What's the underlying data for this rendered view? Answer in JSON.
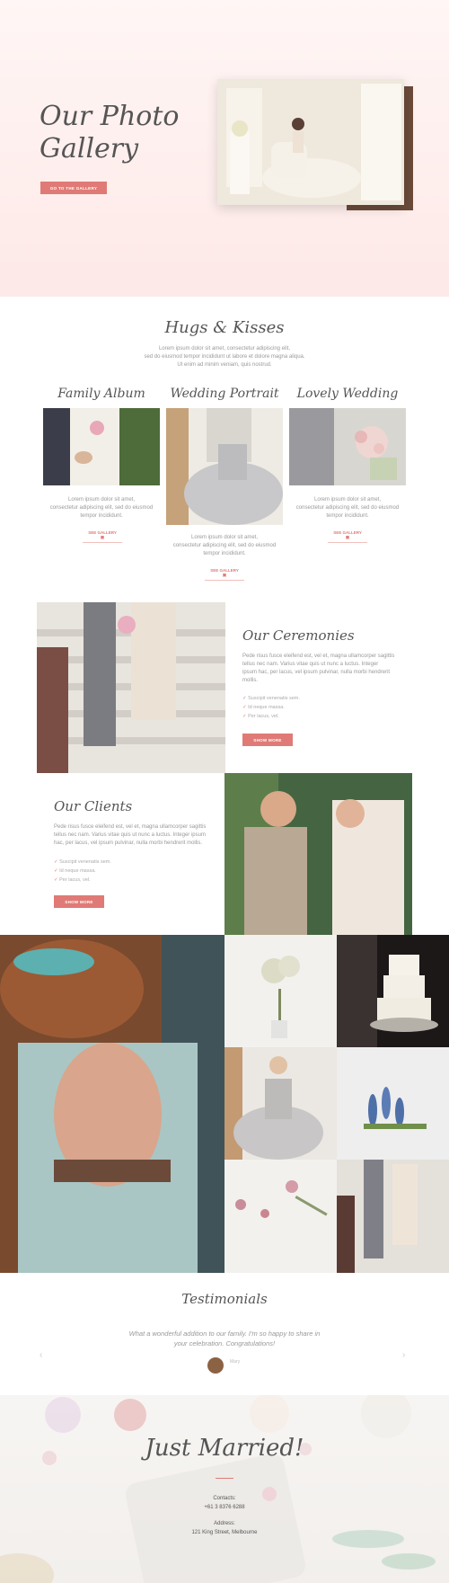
{
  "hero": {
    "title_line1": "Our Photo",
    "title_line2": "Gallery",
    "button_label": "GO TO THE GALLERY"
  },
  "hugs": {
    "title": "Hugs & Kisses",
    "text_line1": "Lorem ipsum dolor sit amet, consectetur adipiscing elit,",
    "text_line2": "sed do eiusmod tempor incididunt ut labore et dolore magna aliqua.",
    "text_line3": "Ut enim ad minim veniam, quis nostrud."
  },
  "albums": [
    {
      "title": "Family Album",
      "text_line1": "Lorem ipsum dolor sit amet,",
      "text_line2": "consectetur adipiscing elit, sed do eiusmod",
      "text_line3": "tempor incididunt.",
      "link_label": "SEE GALLERY"
    },
    {
      "title": "Wedding Portrait",
      "text_line1": "Lorem ipsum dolor sit amet,",
      "text_line2": "consectetur adipiscing elit, sed do eiusmod",
      "text_line3": "tempor incididunt.",
      "link_label": "SEE GALLERY"
    },
    {
      "title": "Lovely Wedding",
      "text_line1": "Lorem ipsum dolor sit amet,",
      "text_line2": "consectetur adipiscing elit, sed do eiusmod",
      "text_line3": "tempor incididunt.",
      "link_label": "SEE GALLERY"
    }
  ],
  "ceremonies": {
    "title": "Our Ceremonies",
    "text_line1": "Pede risus fusce eleifend est, vel et, magna ullamcorper sagittis",
    "text_line2": "tellus nec nam. Varius vitae quis ut nunc a luctus. Integer",
    "text_line3": "ipsum hac, per lacus, vel ipsum pulvinar, nulla morbi hendrerit",
    "text_line4": "mollis.",
    "list": [
      "Suscipit venenatis sem.",
      "Id neque massa.",
      "Per lacus, vel."
    ],
    "button_label": "SHOW MORE"
  },
  "clients": {
    "title": "Our Clients",
    "text_line1": "Pede risus fusce eleifend est, vel et, magna ullamcorper sagittis",
    "text_line2": "tellus nec nam. Varius vitae quis ut nunc a luctus. Integer ipsum",
    "text_line3": "hac, per lacus, vel ipsum pulvinar, nulla morbi hendrerit mollis.",
    "list": [
      "Suscipit venenatis sem.",
      "Id neque massa.",
      "Per lacus, vel."
    ],
    "button_label": "SHOW MORE"
  },
  "testimonials": {
    "title": "Testimonials",
    "quote_line1": "What a wonderful addition to our family. I'm so happy to share in",
    "quote_line2": "your celebration. Congratulations!",
    "author": "Mary",
    "prev_arrow": "‹",
    "next_arrow": "›"
  },
  "footer": {
    "title": "Just Married!",
    "contact_label": "Contacts:",
    "phone": "+61 3 8376 6288",
    "address_label": "Address:",
    "address": "121 King Street, Melbourne"
  },
  "colors": {
    "accent": "#e07a76",
    "hero_bg": "#fdeeed"
  }
}
